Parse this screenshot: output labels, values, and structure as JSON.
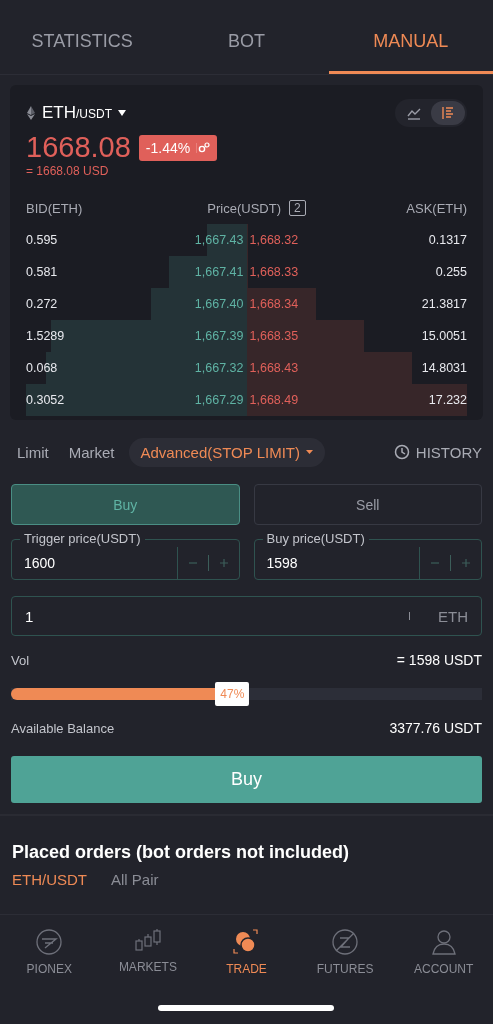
{
  "tabs": [
    {
      "label": "STATISTICS",
      "selected": false
    },
    {
      "label": "BOT",
      "selected": false
    },
    {
      "label": "MANUAL",
      "selected": true
    }
  ],
  "ticker": {
    "base": "ETH",
    "quote": "/USDT",
    "price": "1668.08",
    "change": "-1.44%",
    "price_usd": "= 1668.08 USD",
    "view_toggles": [
      {
        "kind": "chart",
        "selected": false
      },
      {
        "kind": "book",
        "selected": true
      }
    ]
  },
  "order_book": {
    "columns": [
      "BID(ETH)",
      "Price(USDT)",
      "ASK(ETH)"
    ],
    "precision": "2",
    "rows": [
      {
        "bid": "0.595",
        "bid_price": "1,667.43",
        "ask_price": "1,668.32",
        "ask": "0.1317"
      },
      {
        "bid": "0.581",
        "bid_price": "1,667.41",
        "ask_price": "1,668.33",
        "ask": "0.255"
      },
      {
        "bid": "0.272",
        "bid_price": "1,667.40",
        "ask_price": "1,668.34",
        "ask": "21.3817"
      },
      {
        "bid": "1.5289",
        "bid_price": "1,667.39",
        "ask_price": "1,668.35",
        "ask": "15.0051"
      },
      {
        "bid": "0.068",
        "bid_price": "1,667.32",
        "ask_price": "1,668.43",
        "ask": "14.8031"
      },
      {
        "bid": "0.3052",
        "bid_price": "1,667.29",
        "ask_price": "1,668.49",
        "ask": "17.232"
      }
    ]
  },
  "order_types": [
    {
      "label": "Limit",
      "selected": false
    },
    {
      "label": "Market",
      "selected": false
    },
    {
      "label": "Advanced(STOP LIMIT)",
      "selected": true
    }
  ],
  "history": "HISTORY",
  "sides": [
    {
      "label": "Buy",
      "selected": true
    },
    {
      "label": "Sell",
      "selected": false
    }
  ],
  "price_fields": [
    {
      "label": "Trigger price(USDT)",
      "value": "1600"
    },
    {
      "label": "Buy price(USDT)",
      "value": "1598"
    }
  ],
  "amount": {
    "value": "1",
    "unit": "ETH"
  },
  "vol": {
    "label": "Vol",
    "value": "= 1598 USDT"
  },
  "slider": {
    "level": 0.47,
    "reading": "47%"
  },
  "balance": {
    "label": "Available Balance",
    "value": "3377.76 USDT"
  },
  "submit": "Buy",
  "placed_orders": {
    "title": "Placed orders (bot orders not included)",
    "filters": [
      {
        "label": "ETH/USDT",
        "selected": true
      },
      {
        "label": "All Pair",
        "selected": false
      }
    ]
  },
  "nav": [
    {
      "kind": "pionex",
      "label": "PIONEX",
      "selected": false
    },
    {
      "kind": "markets",
      "label": "MARKETS",
      "selected": false
    },
    {
      "kind": "trade",
      "label": "TRADE",
      "selected": true
    },
    {
      "kind": "futures",
      "label": "FUTURES",
      "selected": false
    },
    {
      "kind": "account",
      "label": "ACCOUNT",
      "selected": false
    }
  ]
}
